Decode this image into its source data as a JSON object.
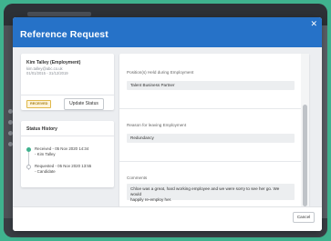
{
  "modal": {
    "title": "Reference Request",
    "close_label": "✕"
  },
  "employment": {
    "name": "Kim Talley (Employment)",
    "email": "kim.talley@abc.co.uk",
    "dates": "01/01/2015 - 31/12/2019",
    "status_badge": "RECEIVED",
    "update_button": "Update Status"
  },
  "status_history": {
    "title": "Status History",
    "entries": [
      {
        "line1": "Received - 05 Nov 2020 14:34",
        "line2": "- Kim Talley"
      },
      {
        "line1": "Requested - 05 Nov 2020 13:55",
        "line2": "- Candidate"
      }
    ]
  },
  "fields": {
    "position": {
      "label": "Position(s) Held during Employment",
      "value": "Talent Business Partner"
    },
    "reason": {
      "label": "Reason for leaving Employment",
      "value": "Redundancy"
    },
    "comments": {
      "label": "Comments",
      "line1": "Chloe was a great, hard working employee and we were sorry to see her go. We would",
      "line2": "happily re-employ her."
    }
  },
  "footer": {
    "cancel_label": "Cancel"
  },
  "colors": {
    "header": "#2672c8",
    "background": "#3fb28e",
    "badge": "#e0b84a"
  }
}
